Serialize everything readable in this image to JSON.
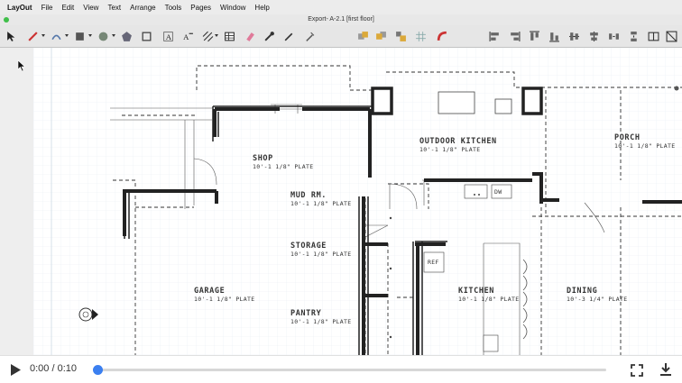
{
  "menubar": {
    "app": "LayOut",
    "items": [
      "File",
      "Edit",
      "View",
      "Text",
      "Arrange",
      "Tools",
      "Pages",
      "Window",
      "Help"
    ]
  },
  "window": {
    "title": "Export- A-2.1 [first floor]"
  },
  "plan": {
    "rooms": [
      {
        "name": "SHOP",
        "sub": "10'-1 1/8\" PLATE"
      },
      {
        "name": "OUTDOOR KITCHEN",
        "sub": "10'-1 1/8\" PLATE"
      },
      {
        "name": "PORCH",
        "sub": "10'-1 1/8\" PLATE"
      },
      {
        "name": "MUD RM.",
        "sub": "10'-1 1/8\" PLATE"
      },
      {
        "name": "STORAGE",
        "sub": "10'-1 1/8\" PLATE"
      },
      {
        "name": "GARAGE",
        "sub": "10'-1 1/8\" PLATE"
      },
      {
        "name": "KITCHEN",
        "sub": "10'-1 1/8\" PLATE"
      },
      {
        "name": "DINING",
        "sub": "10'-3 1/4\" PLATE"
      },
      {
        "name": "PANTRY",
        "sub": "10'-1 1/8\" PLATE"
      }
    ],
    "fixture_labels": {
      "dw": "DW",
      "ref": "REF"
    }
  },
  "player": {
    "time": "0:00 / 0:10",
    "progress": 0
  }
}
